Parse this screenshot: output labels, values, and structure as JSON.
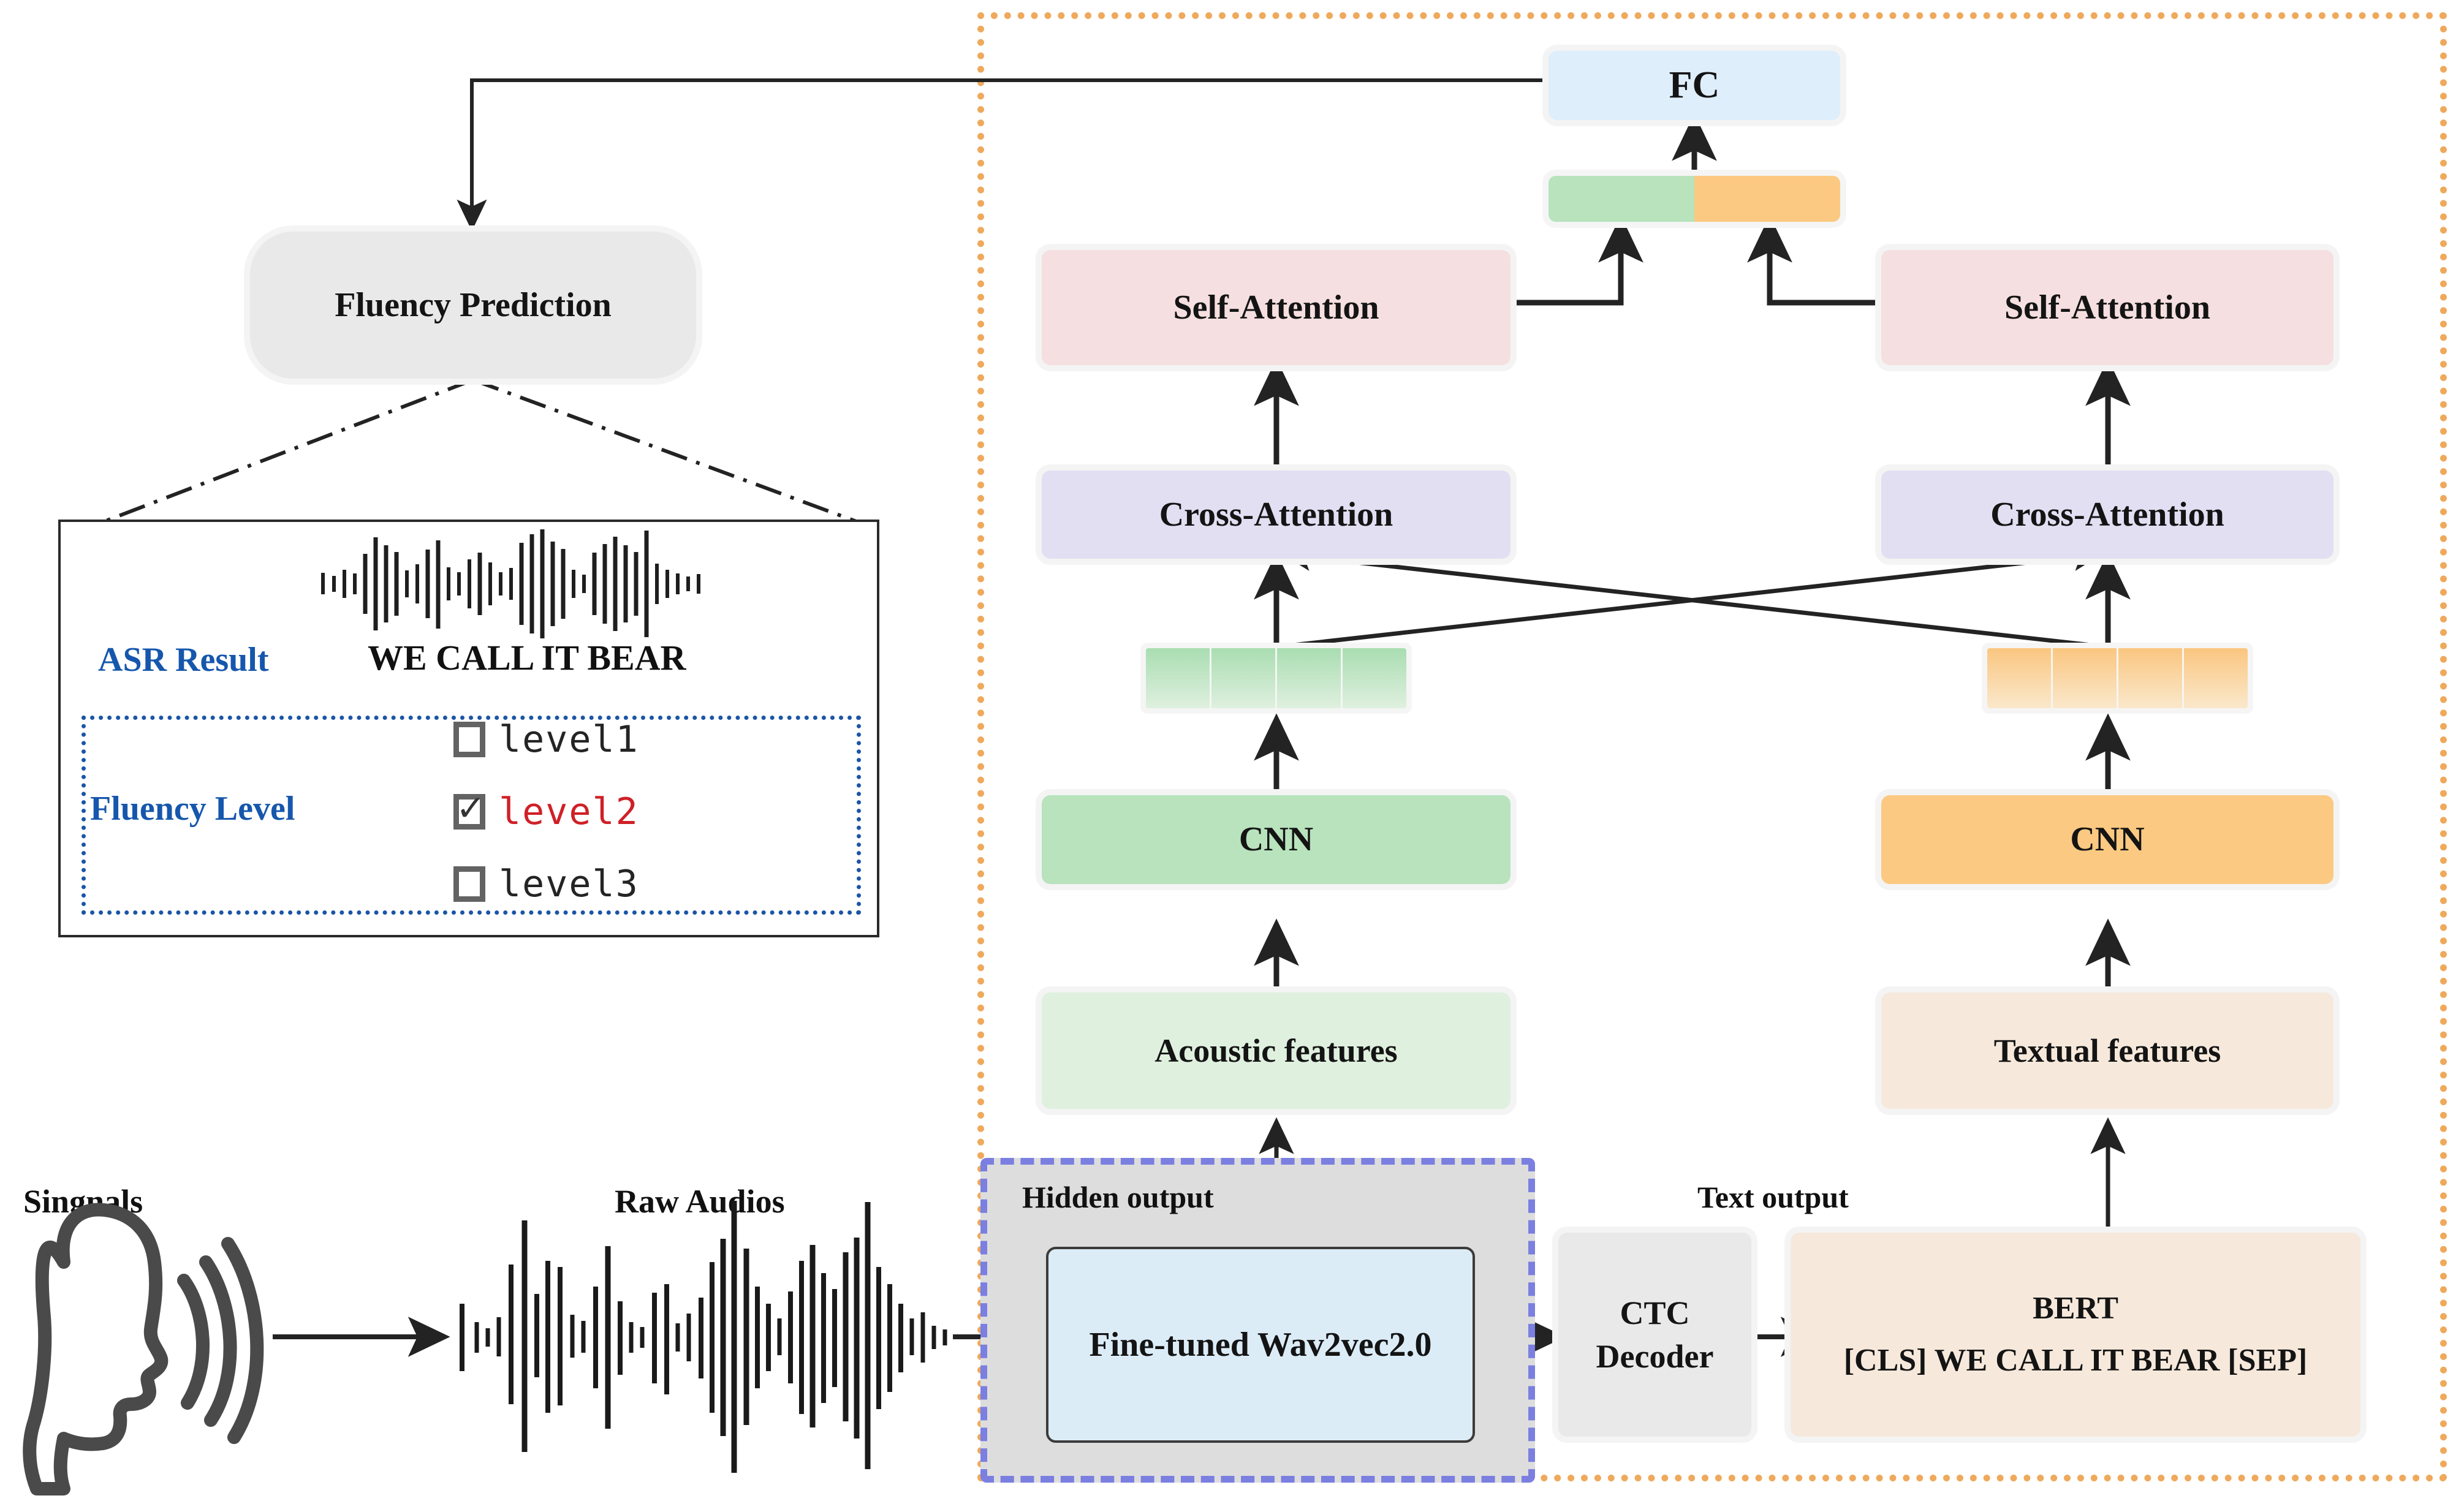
{
  "diagram": {
    "title": "Multimodal fluency prediction architecture",
    "colors": {
      "fc_blue": "#deeefa",
      "self_attention_pink": "#f6dfe0",
      "cross_attention_purple": "#e2dff3",
      "cnn_green": "#b8e3bd",
      "cnn_orange": "#fbc981",
      "acoustic_green": "#dff0df",
      "textual_orange": "#f6e9db",
      "wav2vec_blue": "#dcecf7",
      "ctc_grey": "#e9e9e9",
      "fluency_grey": "#e9e9e9",
      "frame_orange": "#efa95c",
      "frame_blue": "#7b7fe0",
      "label_blue": "#1657ad",
      "selected_red": "#cf2027"
    }
  },
  "left_panel": {
    "fluency_prediction_label": "Fluency Prediction",
    "asr_card": {
      "asr_result_label": "ASR Result",
      "asr_result_text": "WE CALL IT BEAR",
      "fluency_level_label": "Fluency Level",
      "levels": [
        {
          "label": "level1",
          "checked": false,
          "mark": ""
        },
        {
          "label": "level2",
          "checked": true,
          "mark": "✓"
        },
        {
          "label": "level3",
          "checked": false,
          "mark": ""
        }
      ]
    }
  },
  "input_chain": {
    "signals_label": "Singnals",
    "raw_audios_label": "Raw Audios"
  },
  "model": {
    "fc_label": "FC",
    "acoustic_branch": {
      "self_attention_label": "Self-Attention",
      "cross_attention_label": "Cross-Attention",
      "cnn_label": "CNN",
      "features_label": "Acoustic features",
      "token_count": 4
    },
    "textual_branch": {
      "self_attention_label": "Self-Attention",
      "cross_attention_label": "Cross-Attention",
      "cnn_label": "CNN",
      "features_label": "Textual features",
      "token_count": 4
    },
    "encoder_row": {
      "hidden_output_label": "Hidden output",
      "wav2vec_label": "Fine-tuned Wav2vec2.0",
      "text_output_label": "Text output",
      "ctc_label_line1": "CTC",
      "ctc_label_line2": "Decoder",
      "bert_label": "BERT",
      "bert_tokens": "[CLS] WE CALL IT BEAR [SEP]"
    }
  }
}
